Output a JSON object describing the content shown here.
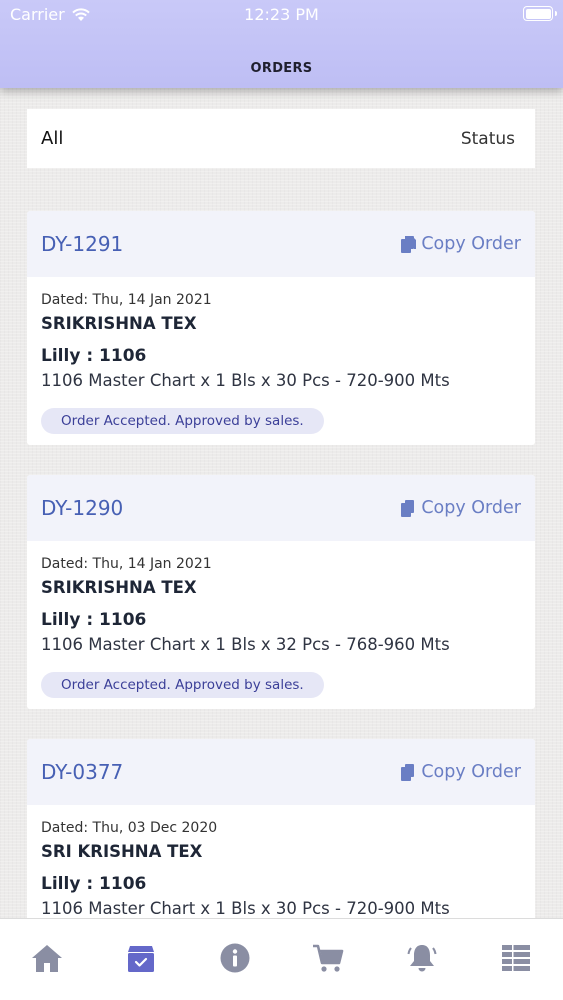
{
  "status_bar": {
    "carrier": "Carrier",
    "time": "12:23 PM"
  },
  "header": {
    "title": "ORDERS"
  },
  "filter": {
    "left": "All",
    "right": "Status"
  },
  "orders": [
    {
      "id": "DY-1291",
      "copy_label": "Copy Order",
      "dated": "Dated: Thu, 14 Jan 2021",
      "customer": "SRIKRISHNA TEX",
      "product": "Lilly : 1106",
      "detail": "1106 Master Chart x 1 Bls x 30 Pcs - 720-900 Mts",
      "status": "Order Accepted. Approved by sales."
    },
    {
      "id": "DY-1290",
      "copy_label": "Copy Order",
      "dated": "Dated: Thu, 14 Jan 2021",
      "customer": "SRIKRISHNA TEX",
      "product": "Lilly : 1106",
      "detail": "1106 Master Chart x 1 Bls x 32 Pcs - 768-960 Mts",
      "status": "Order Accepted. Approved by sales."
    },
    {
      "id": "DY-0377",
      "copy_label": "Copy Order",
      "dated": "Dated: Thu, 03 Dec 2020",
      "customer": "SRI KRISHNA TEX",
      "product": "Lilly : 1106",
      "detail": "1106 Master Chart x 1 Bls x 30 Pcs - 720-900 Mts",
      "status": ""
    }
  ],
  "tabbar": {
    "tabs": [
      {
        "icon": "home-icon",
        "active": false
      },
      {
        "icon": "orders-box-icon",
        "active": true
      },
      {
        "icon": "info-icon",
        "active": false
      },
      {
        "icon": "cart-icon",
        "active": false
      },
      {
        "icon": "bell-icon",
        "active": false
      },
      {
        "icon": "menu-list-icon",
        "active": false
      }
    ]
  },
  "colors": {
    "header": "#c4c4f6",
    "accent": "#4760b4",
    "tab_icon": "#8a8ea3",
    "tab_icon_active": "#6468c9"
  }
}
